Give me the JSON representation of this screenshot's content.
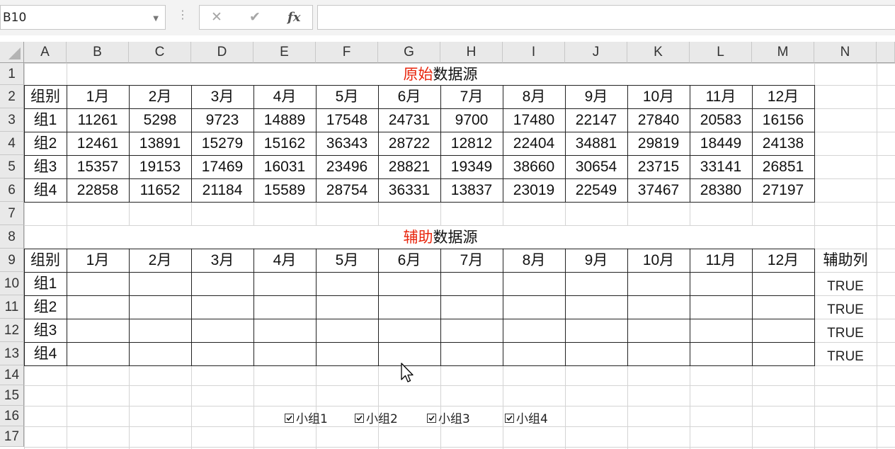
{
  "formula_bar": {
    "name_box": "B10",
    "formula": ""
  },
  "columns": [
    "A",
    "B",
    "C",
    "D",
    "E",
    "F",
    "G",
    "H",
    "I",
    "J",
    "K",
    "L",
    "M",
    "N"
  ],
  "rows": [
    "1",
    "2",
    "3",
    "4",
    "5",
    "6",
    "7",
    "8",
    "9",
    "10",
    "11",
    "12",
    "13",
    "14",
    "15",
    "16",
    "17"
  ],
  "table1": {
    "title_red": "原始",
    "title_black": "数据源",
    "headers": [
      "组别",
      "1月",
      "2月",
      "3月",
      "4月",
      "5月",
      "6月",
      "7月",
      "8月",
      "9月",
      "10月",
      "11月",
      "12月"
    ],
    "data": [
      [
        "组1",
        "11261",
        "5298",
        "9723",
        "14889",
        "17548",
        "24731",
        "9700",
        "17480",
        "22147",
        "27840",
        "20583",
        "16156"
      ],
      [
        "组2",
        "12461",
        "13891",
        "15279",
        "15162",
        "36343",
        "28722",
        "12812",
        "22404",
        "34881",
        "29819",
        "18449",
        "24138"
      ],
      [
        "组3",
        "15357",
        "19153",
        "17469",
        "16031",
        "23496",
        "28821",
        "19349",
        "38660",
        "30654",
        "23715",
        "33141",
        "26851"
      ],
      [
        "组4",
        "22858",
        "11652",
        "21184",
        "15589",
        "28754",
        "36331",
        "13837",
        "23019",
        "22549",
        "37467",
        "28380",
        "27197"
      ]
    ]
  },
  "table2": {
    "title_red": "辅助",
    "title_black": "数据源",
    "headers": [
      "组别",
      "1月",
      "2月",
      "3月",
      "4月",
      "5月",
      "6月",
      "7月",
      "8月",
      "9月",
      "10月",
      "11月",
      "12月"
    ],
    "aux_header": "辅助列",
    "groups": [
      "组1",
      "组2",
      "组3",
      "组4"
    ],
    "aux_values": [
      "TRUE",
      "TRUE",
      "TRUE",
      "TRUE"
    ]
  },
  "checkboxes": [
    {
      "label": "小组1",
      "checked": true
    },
    {
      "label": "小组2",
      "checked": true
    },
    {
      "label": "小组3",
      "checked": true
    },
    {
      "label": "小组4",
      "checked": true
    }
  ],
  "colors": {
    "accent_red": "#e8250c",
    "header_bg": "#e9e9e9",
    "gridline": "#d4d4d4"
  }
}
